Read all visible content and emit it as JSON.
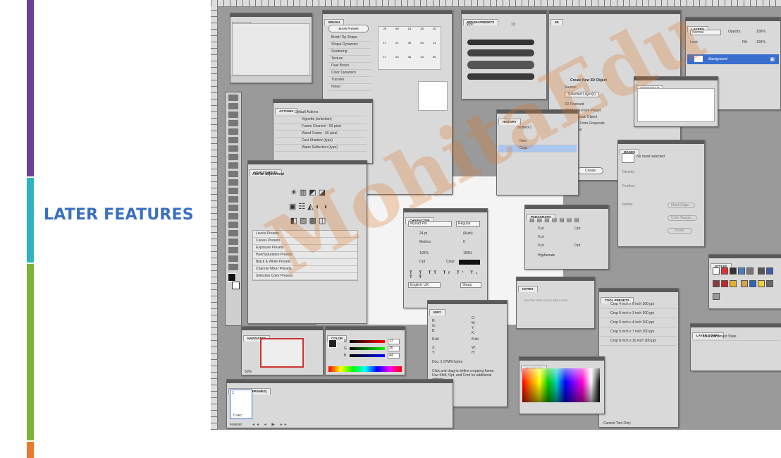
{
  "slide": {
    "title": "LATER FEATURES",
    "stripe_colors": [
      "#6d3f98",
      "#2fb3c4",
      "#7fb23a",
      "#e87a2c"
    ]
  },
  "panels": {
    "paths": {
      "tab": "PATHS"
    },
    "brush": {
      "tab": "BRUSH",
      "button": "Brush Presets",
      "options": [
        "Brush Tip Shape",
        "Shape Dynamics",
        "Scattering",
        "Texture",
        "Dual Brush",
        "Color Dynamics",
        "Transfer",
        "Noise"
      ],
      "numbers": [
        "25",
        "50",
        "25",
        "25",
        "25",
        "17",
        "21",
        "40",
        "54",
        "11",
        "17",
        "23",
        "36",
        "44",
        "60"
      ]
    },
    "brush_presets": {
      "tab": "BRUSH PRESETS",
      "size_label": "Size:",
      "size_value": "13"
    },
    "threed": {
      "tab": "3D",
      "title": "Create New 3D Object",
      "source_label": "Source:",
      "source_value": "Selected Layer(s)",
      "options": [
        "3D Postcard",
        "3D Shape From Preset",
        "3D Repoussé Object",
        "3D Mesh From Grayscale",
        "3D Volume"
      ],
      "button": "Create"
    },
    "layers": {
      "tab": "LAYERS",
      "mode": "Normal",
      "opacity_label": "Opacity:",
      "opacity": "100%",
      "lock_label": "Lock:",
      "fill_label": "Fill:",
      "fill": "100%",
      "layer": "Background"
    },
    "actions": {
      "tab": "ACTIONS",
      "set": "Default Actions",
      "items": [
        "Vignette (selection)",
        "Frame Channel - 50 pixel",
        "Wood Frame - 50 pixel",
        "Cast Shadow (type)",
        "Water Reflection (type)"
      ]
    },
    "adjustments": {
      "tab": "ADJUSTMENTS",
      "header": "Add an adjustment",
      "presets": [
        "Levels Presets",
        "Curves Presets",
        "Exposure Presets",
        "Hue/Saturation Presets",
        "Black & White Presets",
        "Channel Mixer Presets",
        "Selective Color Presets"
      ]
    },
    "history": {
      "tab": "HISTORY",
      "snapshot": "Untitled-1",
      "items": [
        "New",
        "Crop"
      ]
    },
    "histogram": {
      "tab": "HISTOGRAM"
    },
    "masks": {
      "tab": "MASKS",
      "header": "No mask selected",
      "labels": [
        "Density:",
        "Feather:",
        "Refine:"
      ],
      "buttons": [
        "Mask Edge...",
        "Color Range...",
        "Invert"
      ]
    },
    "character": {
      "tab": "CHARACTER",
      "font": "Myriad Pro",
      "style": "Regular",
      "size": "24 pt",
      "leading": "(Auto)",
      "kerning": "Metrics",
      "tracking": "0",
      "vscale": "100%",
      "hscale": "100%",
      "baseline": "0 pt",
      "color_label": "Color:",
      "language": "English: UK",
      "aa": "Sharp"
    },
    "paragraph": {
      "tab": "PARAGRAPH",
      "fields": [
        "0 pt",
        "0 pt",
        "0 pt",
        "0 pt",
        "0 pt"
      ],
      "hyphenate": "Hyphenate"
    },
    "notes": {
      "tab": "NOTES",
      "hint": "Use the Note tool to add a note"
    },
    "tool_presets": {
      "tab": "TOOL PRESETS",
      "items": [
        "Crop 4 inch x 6 inch 300 ppi",
        "Crop 5 inch x 3 inch 300 ppi",
        "Crop 5 inch x 4 inch 300 ppi",
        "Crop 5 inch x 7 inch 300 ppi",
        "Crop 8 inch x 10 inch 300 ppi"
      ],
      "current": "Current Tool Only"
    },
    "styles": {
      "tab": "STYLES"
    },
    "layer_comps": {
      "tab": "LAYER COMPS",
      "item": "Last Document State"
    },
    "info": {
      "tab": "INFO",
      "doc": "Doc: 2.07M/0 bytes",
      "hint": "Click and drag to define cropping frame. Use Shift, Opt, and Cmd for additional options.",
      "labels": [
        "R:",
        "G:",
        "B:",
        "C:",
        "M:",
        "Y:",
        "K:",
        "8-bit",
        "8-bit",
        "X:",
        "Y:",
        "W:",
        "H:"
      ]
    },
    "navigator": {
      "tab": "NAVIGATOR",
      "zoom": "50%"
    },
    "color": {
      "tab": "COLOR",
      "r_label": "R",
      "g_label": "G",
      "b_label": "B",
      "r": "17",
      "g": "25",
      "b": "44"
    },
    "swatches": {
      "tab": "SWATCHES"
    },
    "animation": {
      "tab": "ANIMATION (FRAMES)",
      "frame_no": "1",
      "delay": "0 sec.",
      "loop": "Forever"
    }
  },
  "watermark": {
    "text": "MohitaEdu"
  }
}
